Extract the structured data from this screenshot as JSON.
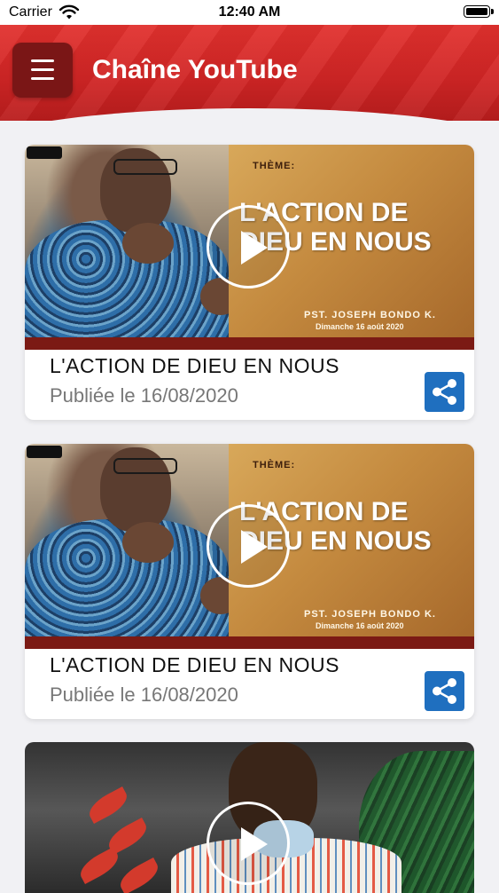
{
  "status_bar": {
    "carrier": "Carrier",
    "time": "12:40 AM"
  },
  "header": {
    "title": "Chaîne YouTube",
    "menu_icon": "hamburger-menu-icon"
  },
  "videos": [
    {
      "title": "L'ACTION DE DIEU EN NOUS",
      "published": "Publiée le 16/08/2020",
      "thumbnail": {
        "theme_label": "THÈME:",
        "title": "L'ACTION DE DIEU EN NOUS",
        "speaker": "PST. JOSEPH BONDO K.",
        "date": "Dimanche 16 août 2020"
      },
      "share_icon": "share-icon"
    },
    {
      "title": "L'ACTION DE DIEU EN NOUS",
      "published": "Publiée le 16/08/2020",
      "thumbnail": {
        "theme_label": "THÈME:",
        "title": "L'ACTION DE DIEU EN NOUS",
        "speaker": "PST. JOSEPH BONDO K.",
        "date": "Dimanche 16 août 2020"
      },
      "share_icon": "share-icon"
    }
  ],
  "colors": {
    "header_red": "#d62a27",
    "menu_button": "#7a1616",
    "share_blue": "#1f6fbf",
    "background": "#f1f1f4"
  }
}
